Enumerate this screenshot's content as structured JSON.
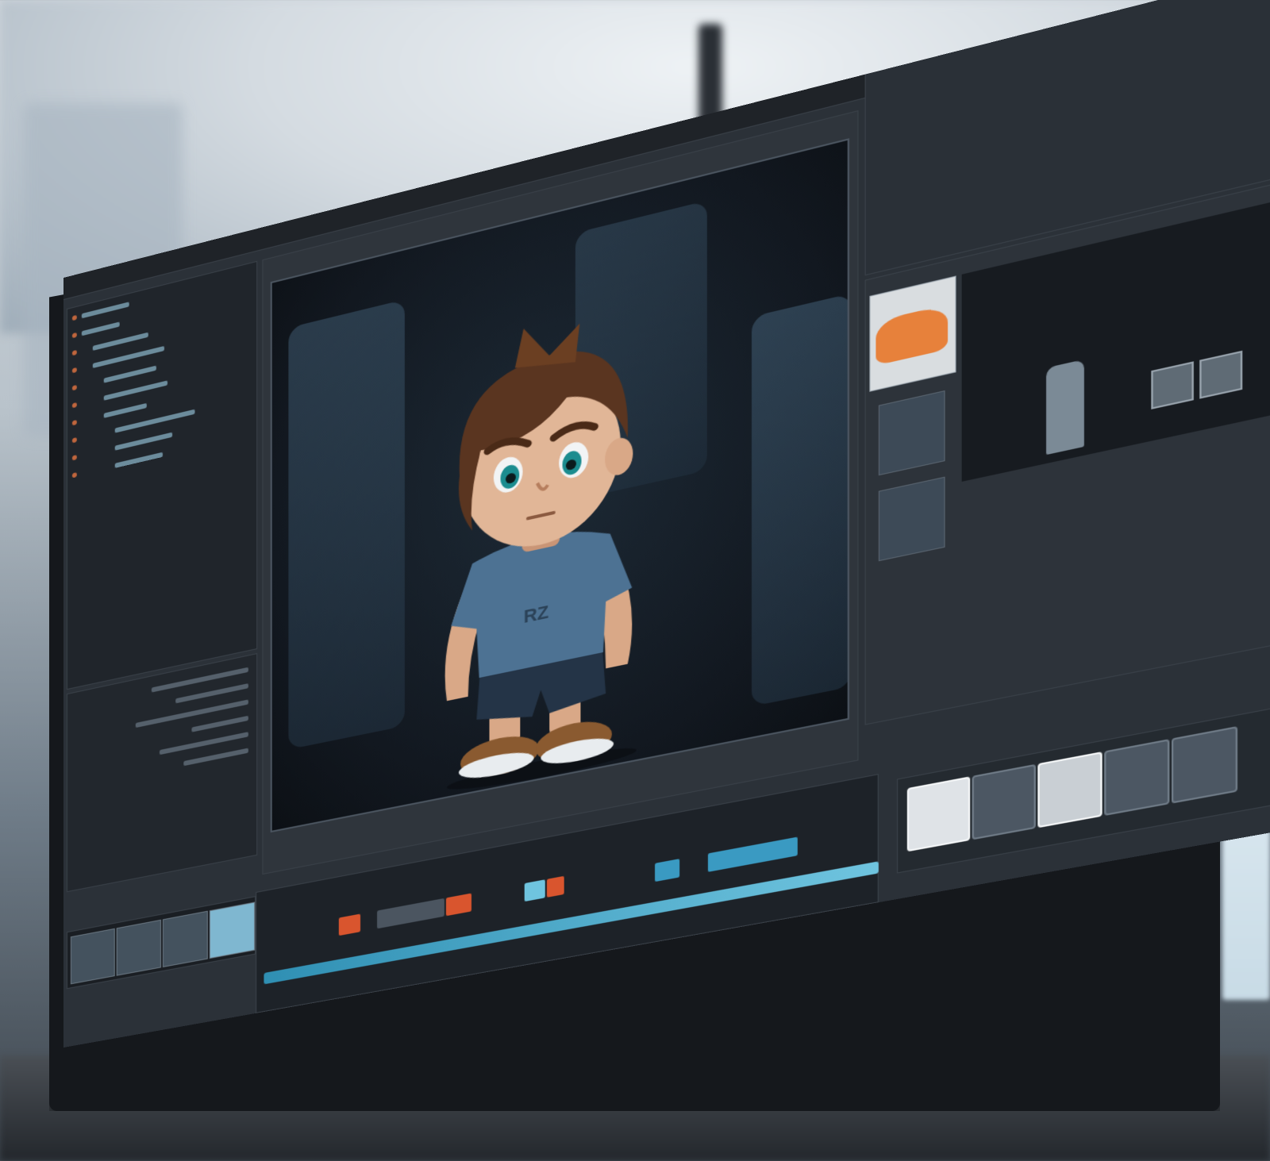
{
  "scene": {
    "description_tag": "",
    "accent_color": "#2f8fb3",
    "clip_colors": [
      "#d9552e",
      "#6fc4df",
      "#8f9aa5"
    ]
  },
  "menubar": {
    "items": [
      "",
      "",
      "",
      "",
      "",
      ""
    ]
  },
  "viewport": {
    "icons": [
      "move-icon",
      "rotate-icon",
      "scale-icon",
      "camera-icon"
    ]
  },
  "toolstrip": {
    "tools": [
      "select-icon",
      "brush-icon",
      "knife-icon",
      "lasso-icon",
      "paint-icon",
      "stretch-icon"
    ]
  }
}
